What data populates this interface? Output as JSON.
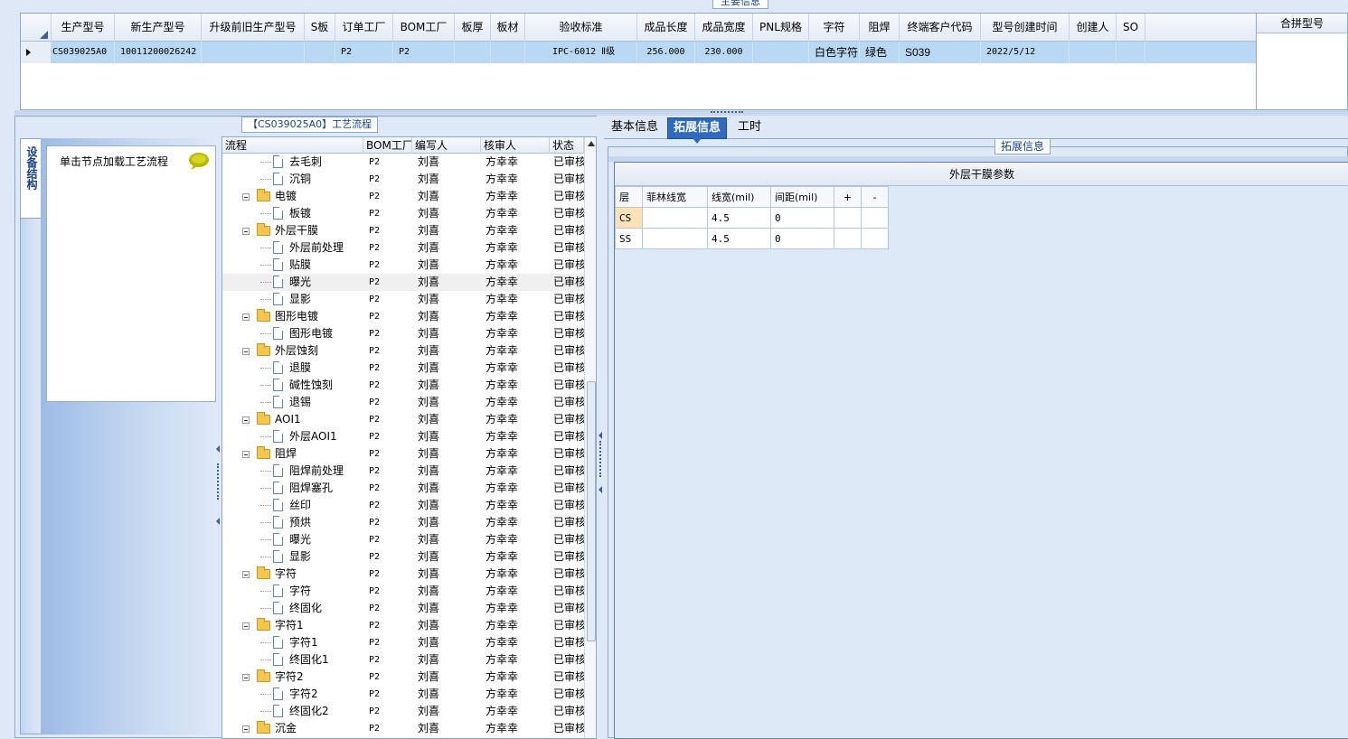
{
  "main_info": {
    "legend": "主要信息",
    "columns": [
      "生产型号",
      "新生产型号",
      "升级前旧生产型号",
      "S板",
      "订单工厂",
      "BOM工厂",
      "板厚",
      "板材",
      "验收标准",
      "成品长度",
      "成品宽度",
      "PNL规格",
      "字符",
      "阻焊",
      "终端客户代码",
      "型号创建时间",
      "创建人",
      "SO"
    ],
    "row": [
      "CS039025A0",
      "10011200026242",
      "",
      "",
      "P2",
      "P2",
      "",
      "",
      "IPC-6012 Ⅱ级",
      "256.000",
      "230.000",
      "",
      "白色字符",
      "绿色",
      "S039",
      "2022/5/12",
      "",
      ""
    ],
    "merge_header": "合拼型号"
  },
  "process": {
    "legend": "【CS039025A0】工艺流程",
    "side_tab": "设备结构",
    "hint": "单击节点加载工艺流程",
    "columns": [
      "流程",
      "BOM工厂",
      "编写人",
      "核审人",
      "状态"
    ],
    "rows": [
      {
        "name": "去毛刺",
        "level": 2,
        "factory": "P2",
        "writer": "刘喜",
        "reviewer": "方幸幸",
        "status": "已审核"
      },
      {
        "name": "沉铜",
        "level": 2,
        "factory": "P2",
        "writer": "刘喜",
        "reviewer": "方幸幸",
        "status": "已审核"
      },
      {
        "name": "电镀",
        "level": 1,
        "factory": "P2",
        "writer": "刘喜",
        "reviewer": "方幸幸",
        "status": "已审核"
      },
      {
        "name": "板镀",
        "level": 2,
        "factory": "P2",
        "writer": "刘喜",
        "reviewer": "方幸幸",
        "status": "已审核"
      },
      {
        "name": "外层干膜",
        "level": 1,
        "factory": "P2",
        "writer": "刘喜",
        "reviewer": "方幸幸",
        "status": "已审核"
      },
      {
        "name": "外层前处理",
        "level": 2,
        "factory": "P2",
        "writer": "刘喜",
        "reviewer": "方幸幸",
        "status": "已审核"
      },
      {
        "name": "贴膜",
        "level": 2,
        "factory": "P2",
        "writer": "刘喜",
        "reviewer": "方幸幸",
        "status": "已审核"
      },
      {
        "name": "曝光",
        "level": 2,
        "factory": "P2",
        "writer": "刘喜",
        "reviewer": "方幸幸",
        "status": "已审核",
        "selected": true
      },
      {
        "name": "显影",
        "level": 2,
        "factory": "P2",
        "writer": "刘喜",
        "reviewer": "方幸幸",
        "status": "已审核"
      },
      {
        "name": "图形电镀",
        "level": 1,
        "factory": "P2",
        "writer": "刘喜",
        "reviewer": "方幸幸",
        "status": "已审核"
      },
      {
        "name": "图形电镀",
        "level": 2,
        "factory": "P2",
        "writer": "刘喜",
        "reviewer": "方幸幸",
        "status": "已审核"
      },
      {
        "name": "外层蚀刻",
        "level": 1,
        "factory": "P2",
        "writer": "刘喜",
        "reviewer": "方幸幸",
        "status": "已审核"
      },
      {
        "name": "退膜",
        "level": 2,
        "factory": "P2",
        "writer": "刘喜",
        "reviewer": "方幸幸",
        "status": "已审核"
      },
      {
        "name": "碱性蚀刻",
        "level": 2,
        "factory": "P2",
        "writer": "刘喜",
        "reviewer": "方幸幸",
        "status": "已审核"
      },
      {
        "name": "退锡",
        "level": 2,
        "factory": "P2",
        "writer": "刘喜",
        "reviewer": "方幸幸",
        "status": "已审核"
      },
      {
        "name": "AOI1",
        "level": 1,
        "factory": "P2",
        "writer": "刘喜",
        "reviewer": "方幸幸",
        "status": "已审核"
      },
      {
        "name": "外层AOI1",
        "level": 2,
        "factory": "P2",
        "writer": "刘喜",
        "reviewer": "方幸幸",
        "status": "已审核"
      },
      {
        "name": "阻焊",
        "level": 1,
        "factory": "P2",
        "writer": "刘喜",
        "reviewer": "方幸幸",
        "status": "已审核"
      },
      {
        "name": "阻焊前处理",
        "level": 2,
        "factory": "P2",
        "writer": "刘喜",
        "reviewer": "方幸幸",
        "status": "已审核"
      },
      {
        "name": "阻焊塞孔",
        "level": 2,
        "factory": "P2",
        "writer": "刘喜",
        "reviewer": "方幸幸",
        "status": "已审核"
      },
      {
        "name": "丝印",
        "level": 2,
        "factory": "P2",
        "writer": "刘喜",
        "reviewer": "方幸幸",
        "status": "已审核"
      },
      {
        "name": "预烘",
        "level": 2,
        "factory": "P2",
        "writer": "刘喜",
        "reviewer": "方幸幸",
        "status": "已审核"
      },
      {
        "name": "曝光",
        "level": 2,
        "factory": "P2",
        "writer": "刘喜",
        "reviewer": "方幸幸",
        "status": "已审核"
      },
      {
        "name": "显影",
        "level": 2,
        "factory": "P2",
        "writer": "刘喜",
        "reviewer": "方幸幸",
        "status": "已审核"
      },
      {
        "name": "字符",
        "level": 1,
        "factory": "P2",
        "writer": "刘喜",
        "reviewer": "方幸幸",
        "status": "已审核"
      },
      {
        "name": "字符",
        "level": 2,
        "factory": "P2",
        "writer": "刘喜",
        "reviewer": "方幸幸",
        "status": "已审核"
      },
      {
        "name": "终固化",
        "level": 2,
        "factory": "P2",
        "writer": "刘喜",
        "reviewer": "方幸幸",
        "status": "已审核"
      },
      {
        "name": "字符1",
        "level": 1,
        "factory": "P2",
        "writer": "刘喜",
        "reviewer": "方幸幸",
        "status": "已审核"
      },
      {
        "name": "字符1",
        "level": 2,
        "factory": "P2",
        "writer": "刘喜",
        "reviewer": "方幸幸",
        "status": "已审核"
      },
      {
        "name": "终固化1",
        "level": 2,
        "factory": "P2",
        "writer": "刘喜",
        "reviewer": "方幸幸",
        "status": "已审核"
      },
      {
        "name": "字符2",
        "level": 1,
        "factory": "P2",
        "writer": "刘喜",
        "reviewer": "方幸幸",
        "status": "已审核"
      },
      {
        "name": "字符2",
        "level": 2,
        "factory": "P2",
        "writer": "刘喜",
        "reviewer": "方幸幸",
        "status": "已审核"
      },
      {
        "name": "终固化2",
        "level": 2,
        "factory": "P2",
        "writer": "刘喜",
        "reviewer": "方幸幸",
        "status": "已审核"
      },
      {
        "name": "沉金",
        "level": 1,
        "factory": "P2",
        "writer": "刘喜",
        "reviewer": "方幸幸",
        "status": "已审核"
      }
    ]
  },
  "detail": {
    "tabs": [
      "基本信息",
      "拓展信息",
      "工时"
    ],
    "active_tab": "拓展信息",
    "legend": "拓展信息",
    "param_title": "外层干膜参数",
    "columns": [
      "层",
      "菲林线宽",
      "线宽(mil)",
      "间距(mil)",
      "+",
      "-"
    ],
    "rows": [
      [
        "CS",
        "",
        "4.5",
        "0",
        "",
        ""
      ],
      [
        "SS",
        "",
        "4.5",
        "0",
        "",
        ""
      ]
    ]
  },
  "colors": {
    "accent": "#2e6bbf",
    "selected_row": "#b9d8f4",
    "panel_bg": "#dfe8f6",
    "layer_highlight": "#fde2b8"
  }
}
